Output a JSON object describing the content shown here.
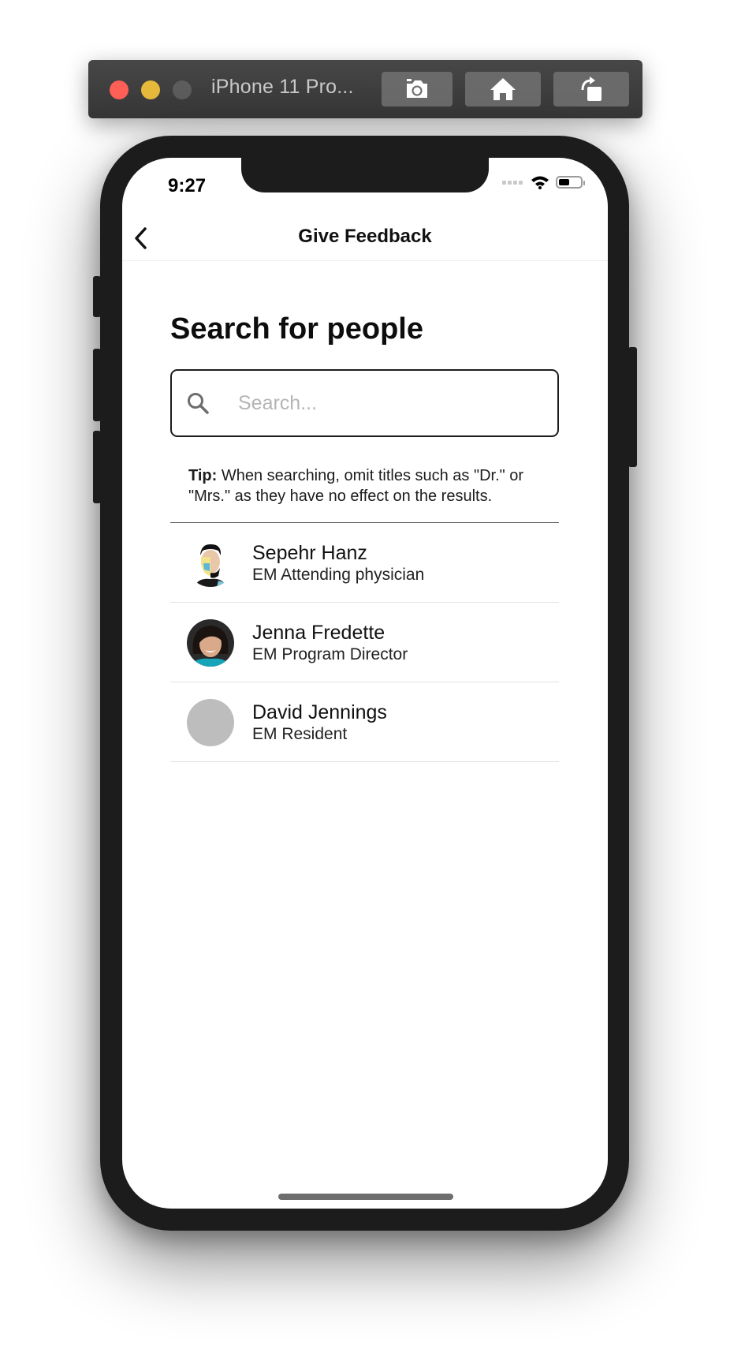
{
  "simulator": {
    "title": "iPhone 11 Pro...",
    "buttons": {
      "screenshot_icon": "camera-icon",
      "home_icon": "home-icon",
      "rotate_icon": "rotate-icon"
    }
  },
  "status_bar": {
    "time": "9:27",
    "battery_level": 0.5
  },
  "nav": {
    "title": "Give Feedback",
    "back_icon": "chevron-left-icon"
  },
  "search": {
    "heading": "Search for people",
    "placeholder": "Search...",
    "value": ""
  },
  "tip": {
    "label": "Tip:",
    "text": " When searching, omit titles such as \"Dr.\" or \"Mrs.\" as they have no effect on the results."
  },
  "people": [
    {
      "name": "Sepehr Hanz",
      "role": "EM Attending physician"
    },
    {
      "name": "Jenna Fredette",
      "role": "EM Program Director"
    },
    {
      "name": "David Jennings",
      "role": "EM Resident"
    }
  ],
  "colors": {
    "device_frame": "#1c1c1c",
    "placeholder_text": "#b5b5b5",
    "avatar_placeholder": "#bdbdbd",
    "traffic_red": "#fe5f57",
    "traffic_yellow": "#e6b93b"
  }
}
